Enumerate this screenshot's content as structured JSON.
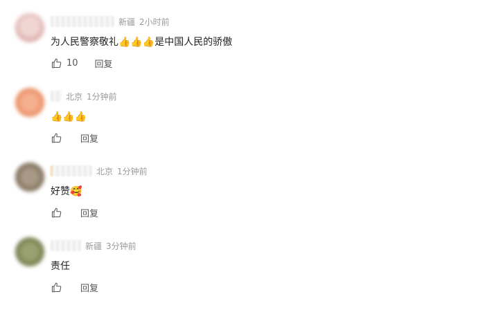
{
  "comments": [
    {
      "location": "新疆",
      "time": "2小时前",
      "text": "为人民警察敬礼👍👍👍是中国人民的骄傲",
      "likes": "10",
      "reply_label": "回复",
      "avatar_color": "#e8c3c0"
    },
    {
      "location": "北京",
      "time": "1分钟前",
      "text": "👍👍👍",
      "likes": "",
      "reply_label": "回复",
      "avatar_color": "#f0a07a"
    },
    {
      "location": "北京",
      "time": "1分钟前",
      "text": "好赞🥰",
      "likes": "",
      "reply_label": "回复",
      "avatar_color": "#9a8a74"
    },
    {
      "location": "新疆",
      "time": "3分钟前",
      "text": "责任",
      "likes": "",
      "reply_label": "回复",
      "avatar_color": "#8a9466"
    }
  ]
}
